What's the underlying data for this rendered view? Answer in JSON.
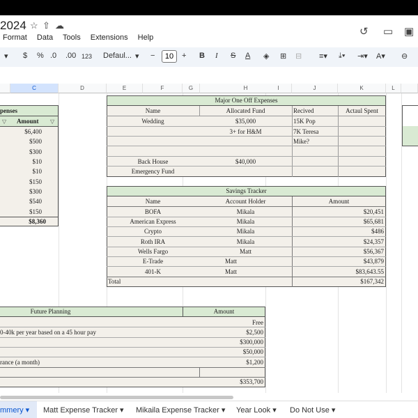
{
  "app": {
    "title": "2024"
  },
  "menu": [
    "Format",
    "Data",
    "Tools",
    "Extensions",
    "Help"
  ],
  "toolbar": {
    "dollar": "$",
    "percent": "%",
    "dec_dec": ".0",
    "inc_dec": ".00",
    "fmt123": "123",
    "font": "Defaul...",
    "font_size": "10",
    "minus": "−",
    "plus": "+",
    "bold": "B",
    "italic": "I",
    "strike": "S",
    "textcolor": "A"
  },
  "columns": [
    "C",
    "D",
    "E",
    "F",
    "G",
    "H",
    "I",
    "J",
    "K",
    "L"
  ],
  "expenses": {
    "header": "penses",
    "amount_header": "Amount",
    "values": [
      "$6,400",
      "$500",
      "$300",
      "$10",
      "$10",
      "$150",
      "$300",
      "$540",
      "$150"
    ],
    "total": "$8,360"
  },
  "major": {
    "title": "Major One Off Expenses",
    "headers": [
      "Name",
      "Allocated Fund",
      "Recived",
      "Actaul Spent"
    ],
    "rows": [
      [
        "Wedding",
        "$35,000",
        "15K Pop",
        ""
      ],
      [
        "",
        "3+ for H&M",
        "7K Teresa",
        ""
      ],
      [
        "",
        "",
        "Mike?",
        ""
      ],
      [
        "",
        "",
        "",
        ""
      ],
      [
        "Back House",
        "$40,000",
        "",
        ""
      ],
      [
        "Emergency Fund",
        "",
        "",
        ""
      ]
    ]
  },
  "savings": {
    "title": "Savings Tracker",
    "headers": [
      "Name",
      "Account Holder",
      "Amount"
    ],
    "rows": [
      [
        "BOFA",
        "Mikala",
        "$20,451"
      ],
      [
        "American Express",
        "Mikala",
        "$65,681"
      ],
      [
        "Crypto",
        "Mikala",
        "$486"
      ],
      [
        "Roth IRA",
        "Mikala",
        "$24,357"
      ],
      [
        "Wells Fargo",
        "Matt",
        "$56,367"
      ],
      [
        "E-Trade",
        "Matt",
        "$43,879"
      ],
      [
        "401-K",
        "Matt",
        "$83,643.55"
      ]
    ],
    "total_label": "Total",
    "total": "$167,342"
  },
  "future": {
    "title": "Future Planning",
    "amount_header": "Amount",
    "rows": [
      [
        "",
        "Free"
      ],
      [
        "0-40k per year based on a 45 hour pay",
        "$2,500"
      ],
      [
        "",
        "$300,000"
      ],
      [
        "",
        "$50,000"
      ],
      [
        "rance (a month)",
        "$1,200"
      ],
      [
        "",
        ""
      ],
      [
        "",
        "$353,700"
      ]
    ]
  },
  "tabs": [
    "mmery",
    "Matt Expense Tracker",
    "Mikaila Expense Tracker",
    "Year Look",
    "Do Not Use"
  ]
}
